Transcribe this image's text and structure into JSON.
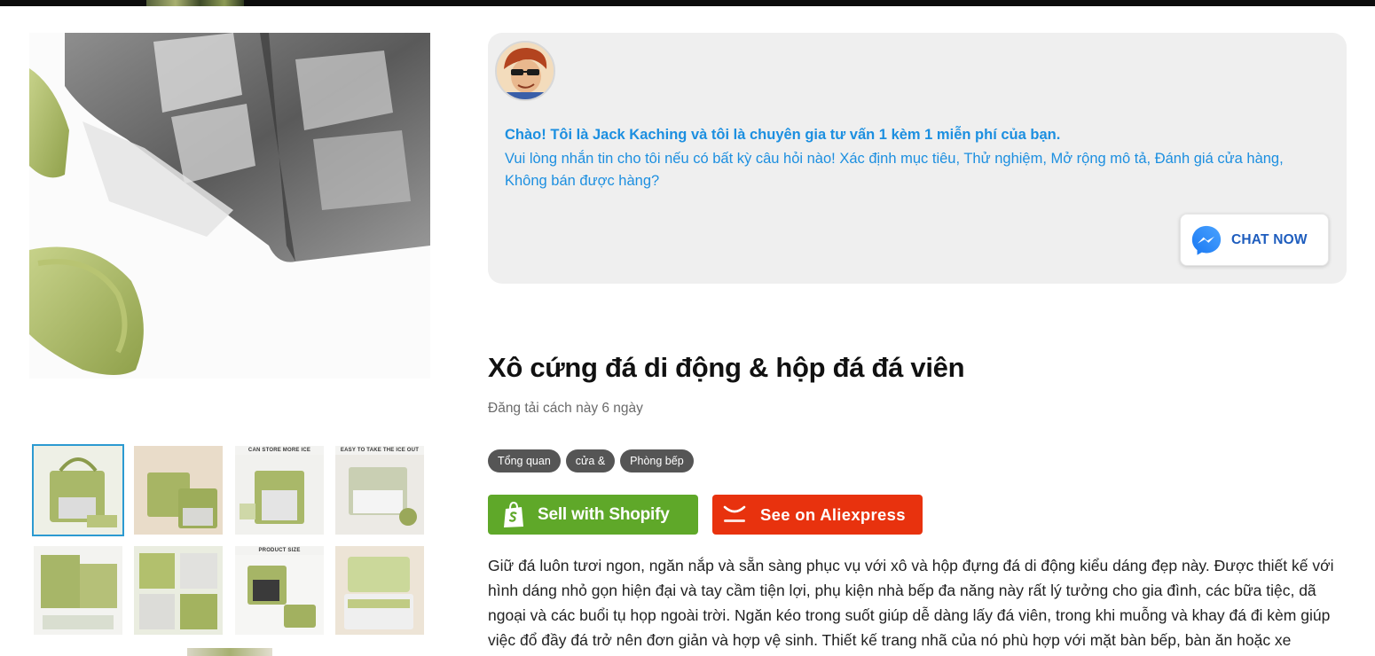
{
  "product": {
    "title": "Xô cứng đá di động & hộp đá đá viên",
    "posted": "Đăng tải cách này 6 ngày",
    "tags": [
      "Tổng quan",
      "cửa &",
      "Phòng bếp"
    ],
    "description": "Giữ đá luôn tươi ngon, ngăn nắp và sẵn sàng phục vụ với xô và hộp đựng đá di động kiểu dáng đẹp này. Được thiết kế với hình dáng nhỏ gọn hiện đại và tay cầm tiện lợi, phụ kiện nhà bếp đa năng này rất lý tưởng cho gia đình, các bữa tiệc, dã ngoại và các buổi tụ họp ngoài trời. Ngăn kéo trong suốt giúp dễ dàng lấy đá viên, trong khi muỗng và khay đá đi kèm giúp việc đổ đầy đá trở nên đơn giản và hợp vệ sinh. Thiết kế trang nhã của nó phù hợp với mặt bàn bếp, bàn ăn hoặc xe"
  },
  "gallery": {
    "thumb_captions": [
      "",
      "",
      "CAN STORE MORE ICE",
      "EASY TO TAKE THE ICE OUT",
      "",
      "",
      "PRODUCT SIZE",
      ""
    ]
  },
  "chat": {
    "heading": "Chào! Tôi là Jack Kaching và tôi là chuyên gia tư vấn 1 kèm 1 miễn phí của bạn.",
    "body": "Vui lòng nhắn tin cho tôi nếu có bất kỳ câu hỏi nào! Xác định mục tiêu, Thử nghiệm, Mở rộng mô tả, Đánh giá cửa hàng, Không bán được hàng?",
    "button_label": "CHAT NOW"
  },
  "actions": {
    "shopify_label": "Sell with Shopify",
    "aliexpress_label": "See on Aliexpress"
  },
  "colors": {
    "chat_text": "#1c8fe0",
    "shopify_green": "#5fa829",
    "aliexpress_red": "#e8320e",
    "tag_bg": "#555555",
    "selected_thumb_border": "#2c9ad1"
  },
  "icons": {
    "chat_button": "messenger-icon",
    "shopify_button": "shopify-bag-icon",
    "aliexpress_button": "aliexpress-logo-icon"
  }
}
